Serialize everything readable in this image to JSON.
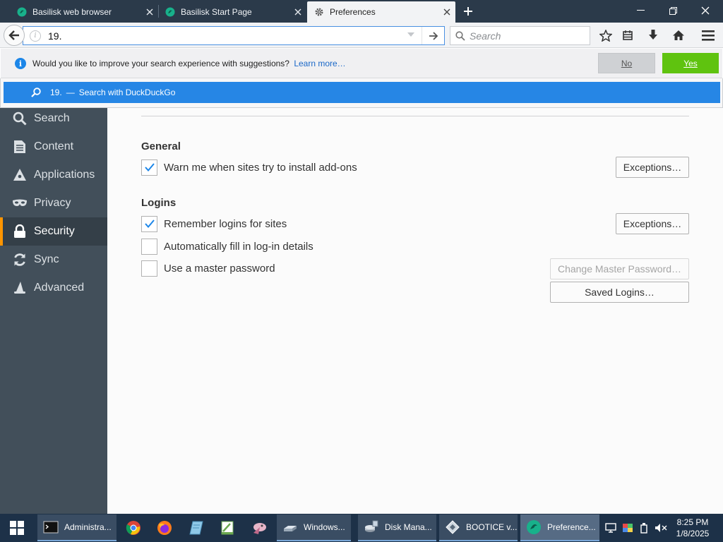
{
  "tabs": [
    {
      "label": "Basilisk web browser",
      "active": false,
      "icon": "basilisk-icon"
    },
    {
      "label": "Basilisk Start Page",
      "active": false,
      "icon": "basilisk-icon"
    },
    {
      "label": "Preferences",
      "active": true,
      "icon": "gear-icon"
    }
  ],
  "nav": {
    "url_value": "19.",
    "search_placeholder": "Search"
  },
  "notification": {
    "text": "Would you like to improve your search experience with suggestions?",
    "link": "Learn more…",
    "no_label": "No",
    "yes_label": "Yes"
  },
  "suggestion": {
    "query": "19.",
    "separator": "—",
    "action": "Search with DuckDuckGo"
  },
  "sidebar": {
    "items": [
      {
        "label": "Search",
        "icon": "search-icon",
        "selected": false
      },
      {
        "label": "Content",
        "icon": "content-icon",
        "selected": false
      },
      {
        "label": "Applications",
        "icon": "applications-icon",
        "selected": false
      },
      {
        "label": "Privacy",
        "icon": "mask-icon",
        "selected": false
      },
      {
        "label": "Security",
        "icon": "lock-icon",
        "selected": true
      },
      {
        "label": "Sync",
        "icon": "sync-icon",
        "selected": false
      },
      {
        "label": "Advanced",
        "icon": "wizard-hat-icon",
        "selected": false
      }
    ]
  },
  "general": {
    "title": "General",
    "warn_addons": {
      "label": "Warn me when sites try to install add-ons",
      "checked": true
    },
    "exceptions_label": "Exceptions…"
  },
  "logins": {
    "title": "Logins",
    "remember": {
      "label": "Remember logins for sites",
      "checked": true
    },
    "autofill": {
      "label": "Automatically fill in log-in details",
      "checked": false
    },
    "master": {
      "label": "Use a master password",
      "checked": false
    },
    "exceptions_label": "Exceptions…",
    "change_master_label": "Change Master Password…",
    "saved_logins_label": "Saved Logins…"
  },
  "taskbar": {
    "items": [
      {
        "label": "Administra...",
        "icon": "cmd-icon"
      },
      {
        "label": "Windows...",
        "icon": "drive-icon"
      },
      {
        "label": "Disk Mana...",
        "icon": "disk-management-icon"
      },
      {
        "label": "BOOTICE v...",
        "icon": "bootice-icon"
      },
      {
        "label": "Preference...",
        "icon": "basilisk-icon"
      }
    ],
    "time": "8:25 PM",
    "date": "1/8/2025"
  },
  "colors": {
    "accent_blue": "#2686e5",
    "yes_green": "#5fc30f",
    "sidebar_bg": "#424f5a",
    "selected_marker": "#ff9500"
  }
}
